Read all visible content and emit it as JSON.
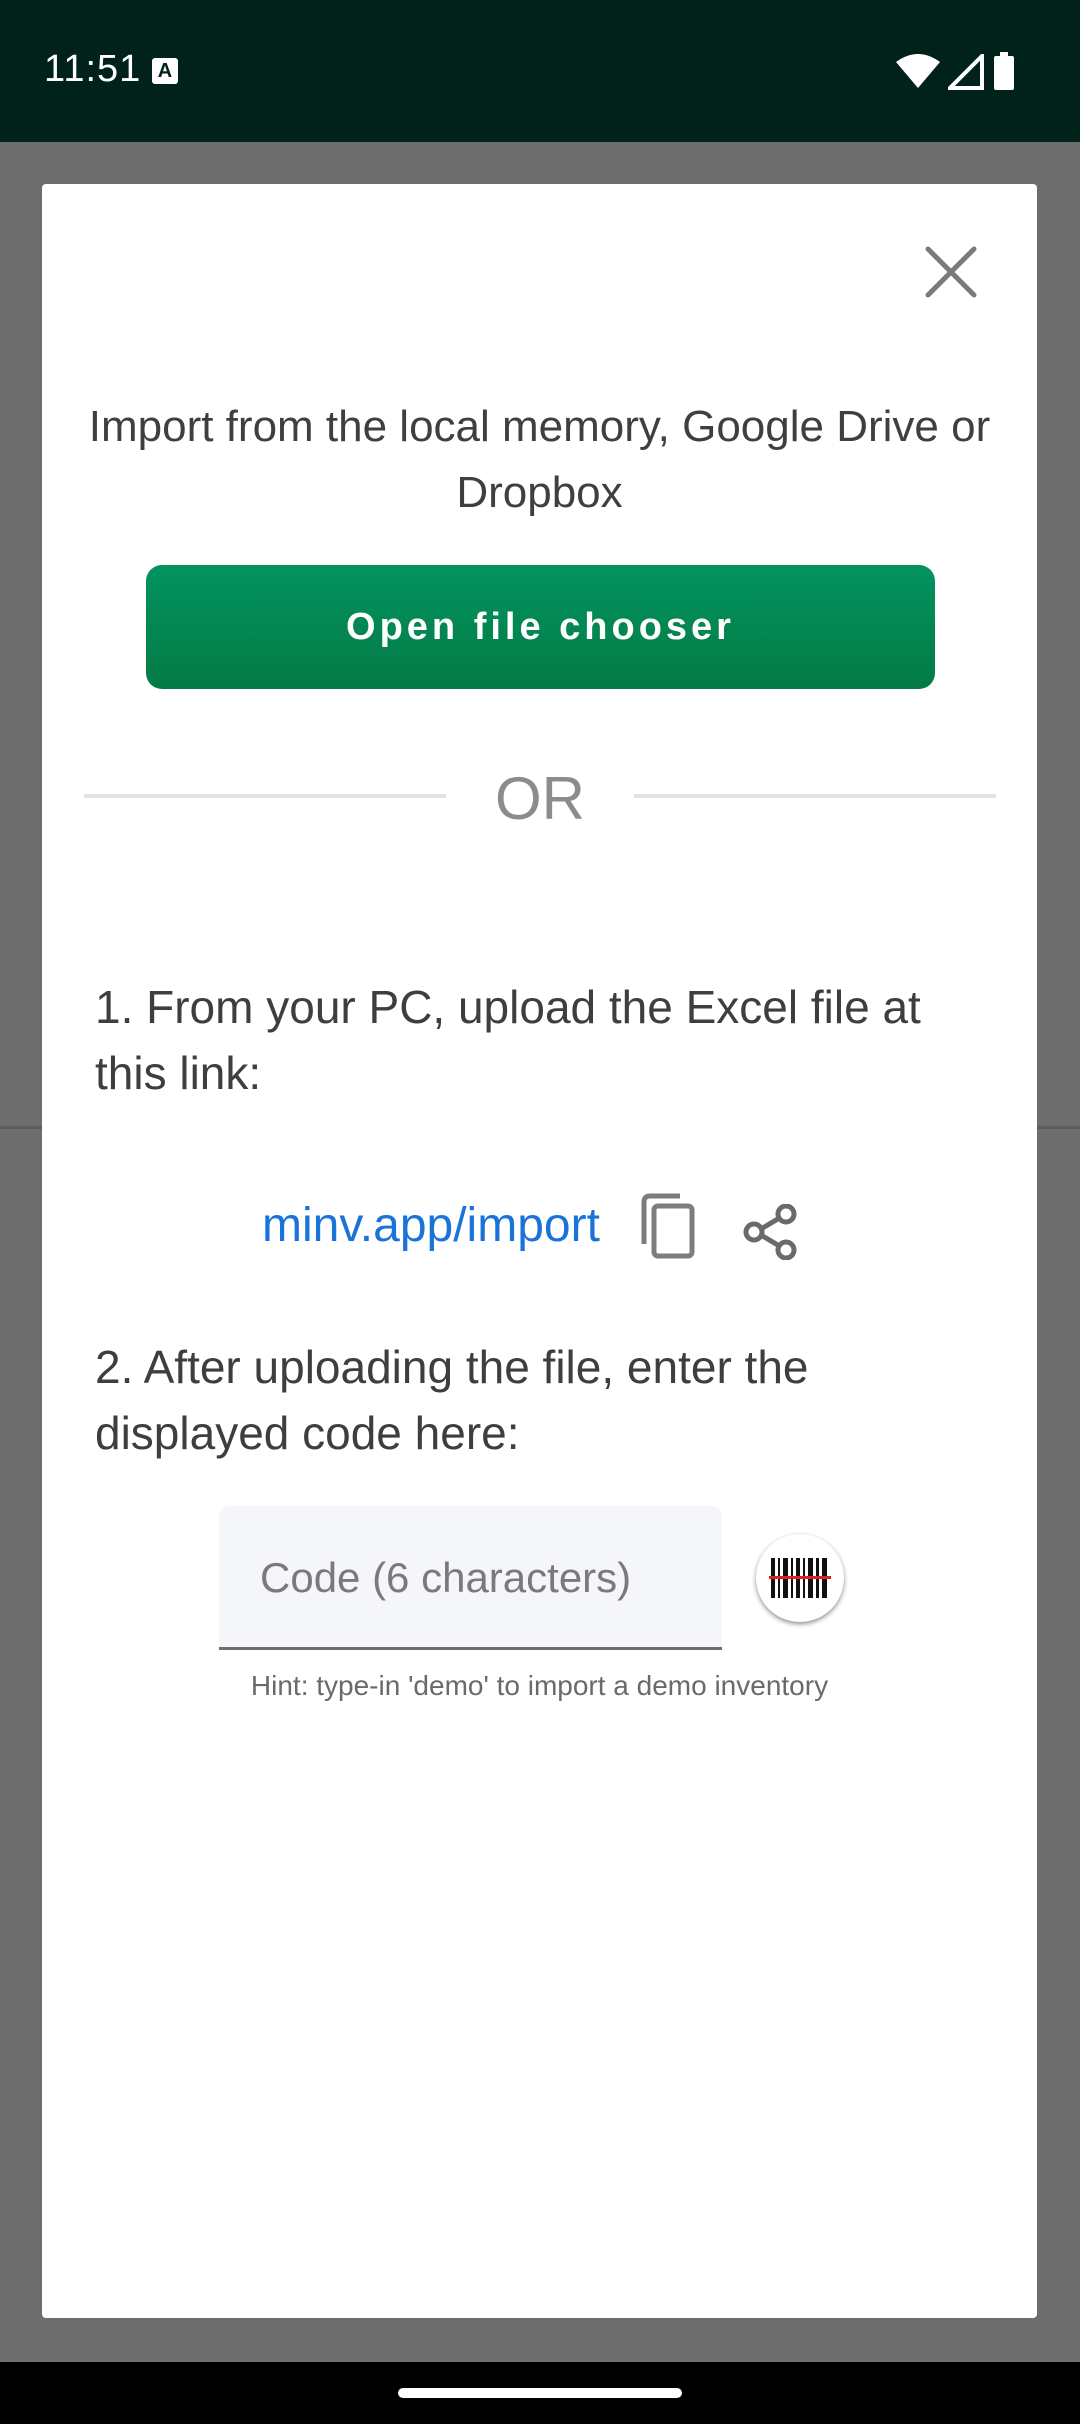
{
  "status_bar": {
    "time": "11:51",
    "notification_icon": "accessibility-a-icon",
    "icons": [
      "wifi-icon",
      "signal-icon",
      "battery-icon"
    ]
  },
  "dialog": {
    "close_icon": "close-icon",
    "import_title": "Import from the local memory, Google Drive or Dropbox",
    "open_button_label": "Open file chooser",
    "or_label": "OR",
    "step1_text": "1. From your PC, upload the Excel file at this link:",
    "import_link": "minv.app/import",
    "copy_icon": "copy-icon",
    "share_icon": "share-icon",
    "step2_text": "2. After uploading the file, enter the displayed code here:",
    "code_placeholder": "Code (6 characters)",
    "scan_icon": "barcode-scan-icon",
    "hint": "Hint: type-in 'demo' to import a demo inventory"
  },
  "colors": {
    "accent_green": "#03874f",
    "link_blue": "#1a73d9",
    "status_bar_bg": "#00221a"
  }
}
